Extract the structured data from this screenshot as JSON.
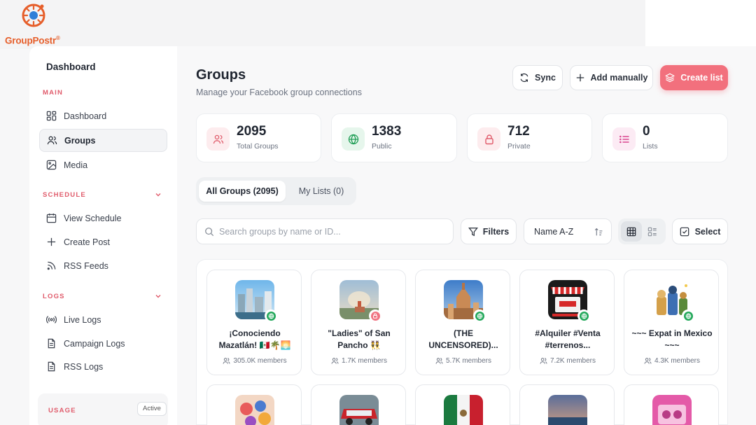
{
  "app": {
    "logo_text": "GroupPostr",
    "trademark": "®",
    "brand_color": "#e65e2a",
    "accent_color": "#f2707d"
  },
  "sidebar": {
    "title": "Dashboard",
    "main_label": "MAIN",
    "main_items": [
      {
        "label": "Dashboard",
        "icon": "layout-grid-icon"
      },
      {
        "label": "Groups",
        "icon": "users-icon",
        "active": true
      },
      {
        "label": "Media",
        "icon": "image-icon"
      }
    ],
    "schedule_label": "SCHEDULE",
    "schedule_items": [
      {
        "label": "View Schedule",
        "icon": "calendar-icon"
      },
      {
        "label": "Create Post",
        "icon": "plus-icon"
      },
      {
        "label": "RSS Feeds",
        "icon": "rss-icon"
      }
    ],
    "logs_label": "LOGS",
    "logs_items": [
      {
        "label": "Live Logs",
        "icon": "broadcast-icon"
      },
      {
        "label": "Campaign Logs",
        "icon": "file-text-icon"
      },
      {
        "label": "RSS Logs",
        "icon": "file-text-icon"
      }
    ],
    "usage": {
      "label": "USAGE",
      "badge": "Active"
    }
  },
  "header": {
    "title": "Groups",
    "subtitle": "Manage your Facebook group connections",
    "sync_label": "Sync",
    "add_label": "Add manually",
    "create_label": "Create list"
  },
  "stats": [
    {
      "value": "2095",
      "label": "Total Groups",
      "icon": "users-icon",
      "color": "#e05b6b",
      "bg": "#fdecee"
    },
    {
      "value": "1383",
      "label": "Public",
      "icon": "globe-icon",
      "color": "#1f9d55",
      "bg": "#e6f6ec"
    },
    {
      "value": "712",
      "label": "Private",
      "icon": "lock-icon",
      "color": "#e05b6b",
      "bg": "#fdecee"
    },
    {
      "value": "0",
      "label": "Lists",
      "icon": "list-icon",
      "color": "#d9468f",
      "bg": "#fcebf4"
    }
  ],
  "tabs": [
    {
      "label": "All Groups (2095)",
      "active": true
    },
    {
      "label": "My Lists (0)",
      "active": false
    }
  ],
  "toolbar": {
    "search_placeholder": "Search groups by name or ID...",
    "filters_label": "Filters",
    "sort_value": "Name A-Z",
    "select_label": "Select"
  },
  "groups": [
    {
      "name": "¡Conociendo Mazatlán! 🇲🇽🌴🌅",
      "members": "305.0K members",
      "privacy": "public"
    },
    {
      "name": "\"Ladies\" of San Pancho 👯",
      "members": "1.7K members",
      "privacy": "private"
    },
    {
      "name": "(THE UNCENSORED)...",
      "members": "5.7K members",
      "privacy": "public"
    },
    {
      "name": "#Alquiler #Venta #terrenos...",
      "members": "7.2K members",
      "privacy": "public"
    },
    {
      "name": "~~~ Expat in Mexico ~~~",
      "members": "4.3K members",
      "privacy": "public"
    }
  ]
}
